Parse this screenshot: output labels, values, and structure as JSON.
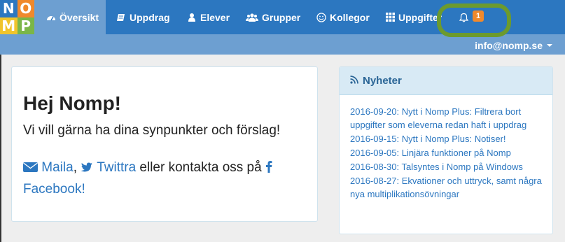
{
  "logo": {
    "letters": [
      "N",
      "O",
      "M",
      "P"
    ],
    "colors": [
      "#2c77c0",
      "#f0892c",
      "#f0c42c",
      "#7ab648"
    ]
  },
  "nav": {
    "items": [
      {
        "label": "Översikt",
        "icon": "dashboard-icon",
        "active": true
      },
      {
        "label": "Uppdrag",
        "icon": "book-icon"
      },
      {
        "label": "Elever",
        "icon": "user-icon"
      },
      {
        "label": "Grupper",
        "icon": "users-icon"
      },
      {
        "label": "Kollegor",
        "icon": "smiley-icon"
      },
      {
        "label": "Uppgifter",
        "icon": "grid-icon"
      }
    ],
    "notifications": {
      "icon": "bell-icon",
      "count": "1"
    },
    "user_email": "info@nomp.se"
  },
  "welcome": {
    "title": "Hej Nomp!",
    "lead": "Vi vill gärna ha dina synpunkter och förslag!",
    "mail_label": "Maila",
    "comma": ",",
    "twitter_label": "Twittra",
    "middle_text": "eller kontakta oss på",
    "facebook_label": "Facebook",
    "end": "!"
  },
  "news": {
    "title": "Nyheter",
    "items": [
      "2016-09-20: Nytt i Nomp Plus: Filtrera bort uppgifter som eleverna redan haft i uppdrag",
      "2016-09-15: Nytt i Nomp Plus: Notiser!",
      "2016-09-05: Linjära funktioner på Nomp",
      "2016-08-30: Talsyntes i Nomp på Windows",
      "2016-08-27: Ekvationer och uttryck, samt några nya multiplikationsövningar"
    ]
  },
  "colors": {
    "nav_bg": "#2c77c0",
    "nav_active": "#6d9fd1",
    "badge": "#f0892c",
    "highlight_ring": "#6c9a2e",
    "link": "#2c77c0"
  }
}
